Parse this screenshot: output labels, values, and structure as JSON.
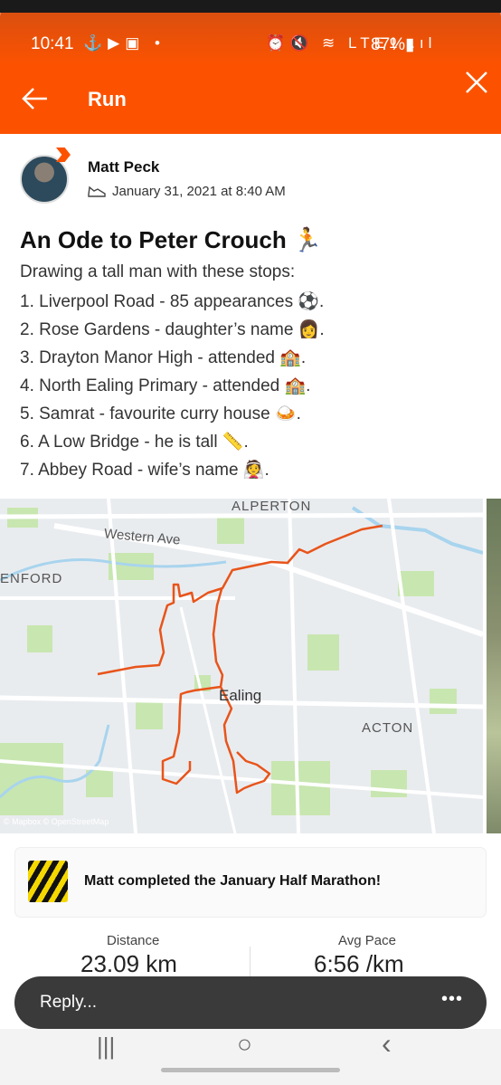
{
  "status_bar": {
    "time": "10:41",
    "left_icons": "⚓▶▣ •",
    "right_icons": "⏰🔇 ≋ LTE1 .ıl",
    "battery": "87%▮"
  },
  "app_bar": {
    "title": "Run",
    "back_icon": "arrow-left",
    "close_icon": "close"
  },
  "post": {
    "athlete_name": "Matt Peck",
    "date": "January 31, 2021 at 8:40 AM",
    "title": "An Ode to Peter Crouch 🏃",
    "description_lines": [
      "Drawing a tall man with these stops:",
      "1. Liverpool Road - 85 appearances ⚽.",
      "2. Rose Gardens - daughter’s name 👩.",
      "3. Drayton Manor High - attended 🏫.",
      "4. North Ealing Primary - attended 🏫.",
      "5. Samrat - favourite curry house 🍛.",
      "6. A Low Bridge - he is tall 📏.",
      "7. Abbey Road - wife’s name 👰."
    ]
  },
  "map": {
    "labels": {
      "alperton": "ALPERTON",
      "western_ave": "Western Ave",
      "perivale": "ENFORD",
      "ealing": "Ealing",
      "acton": "ACTON",
      "attribution": "© Mapbox © OpenStreetMap"
    },
    "route_color": "#e8541a"
  },
  "challenge": {
    "text": "Matt completed the January Half Marathon!"
  },
  "stats": {
    "distance_label": "Distance",
    "distance_value": "23.09 km",
    "pace_label": "Avg Pace",
    "pace_value": "6:56 /km"
  },
  "reply": {
    "placeholder": "Reply...",
    "more": "•••"
  },
  "nav": {
    "recents": "|||",
    "home": "○",
    "back": "‹"
  },
  "colors": {
    "accent": "#fc5200",
    "map_bg": "#e9ecef",
    "park": "#c8e6b0",
    "water": "#a8d4ee"
  }
}
